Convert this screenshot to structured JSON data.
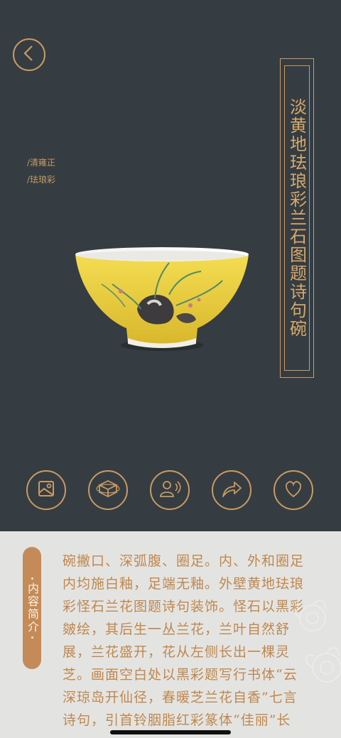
{
  "header": {
    "title": "淡黄地珐琅彩兰石图题诗句碗",
    "dynasty": "/清雍正",
    "category": "/珐琅彩"
  },
  "icons": {
    "back": "back-arrow-icon",
    "actions": [
      "image-icon",
      "3d-cube-icon",
      "audio-guide-icon",
      "share-icon",
      "heart-icon"
    ]
  },
  "intro": {
    "tag": "内容简介",
    "text": "碗撇口、深弧腹、圈足。内、外和圈足内均施白釉，足端无釉。外壁黄地珐琅彩怪石兰花图题诗句装饰。怪石以黑彩皴绘，其后生一丛兰花，兰叶自然舒展，兰花盛开，花从左侧长出一棵灵芝。画面空白处以黑彩题写行书体“云深琼岛开仙径，春暖芝兰花自香”七言诗句，引首铃胭脂红彩篆体“佳丽”长"
  },
  "colors": {
    "background": "#353d42",
    "accent": "#c99a63",
    "panel": "#e3e4e2",
    "tag": "#c48a58",
    "text": "#c0874d"
  }
}
